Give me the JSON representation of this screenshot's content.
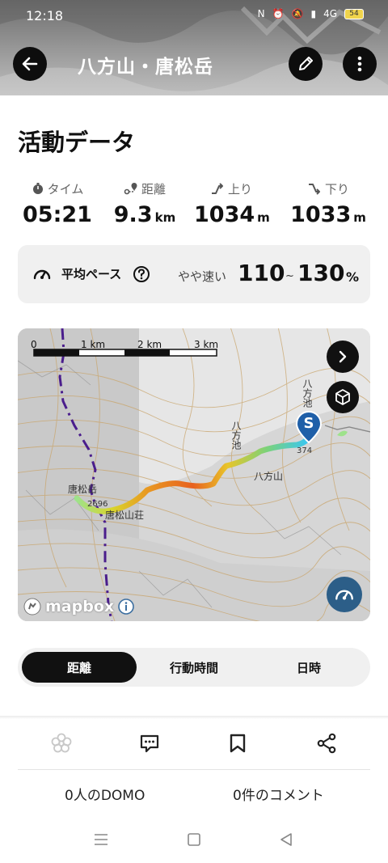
{
  "status_bar": {
    "time": "12:18",
    "network": "4G",
    "battery": "54"
  },
  "header": {
    "title": "八方山・唐松岳"
  },
  "activity": {
    "section_title": "活動データ",
    "stats": [
      {
        "label": "タイム",
        "value": "05:21",
        "unit": ""
      },
      {
        "label": "距離",
        "value": "9.3",
        "unit": "km"
      },
      {
        "label": "上り",
        "value": "1034",
        "unit": "m"
      },
      {
        "label": "下り",
        "value": "1033",
        "unit": "m"
      }
    ],
    "pace": {
      "label": "平均ペース",
      "note": "やや速い",
      "min": "110",
      "separator": "~",
      "max": "130",
      "unit": "%"
    }
  },
  "map": {
    "scale_labels": [
      "0",
      "1 km",
      "2 km",
      "3 km"
    ],
    "place_labels": [
      "唐松岳",
      "2696",
      "唐松山荘",
      "八方池",
      "八方山",
      "八方池",
      "374"
    ],
    "start_marker": "S",
    "attribution": "mapbox",
    "colors": {
      "route_start": "#38c6f4",
      "route_mid": "#e8611f",
      "route_end": "#9ee28b",
      "trail": "#4a1d8c"
    }
  },
  "tabs": [
    {
      "label": "距離",
      "active": true
    },
    {
      "label": "行動時間",
      "active": false
    },
    {
      "label": "日時",
      "active": false
    }
  ],
  "actions": {
    "icons": [
      "domo-icon",
      "comment-icon",
      "bookmark-icon",
      "share-icon"
    ],
    "domo_count_label": "0人のDOMO",
    "comment_count_label": "0件のコメント"
  }
}
